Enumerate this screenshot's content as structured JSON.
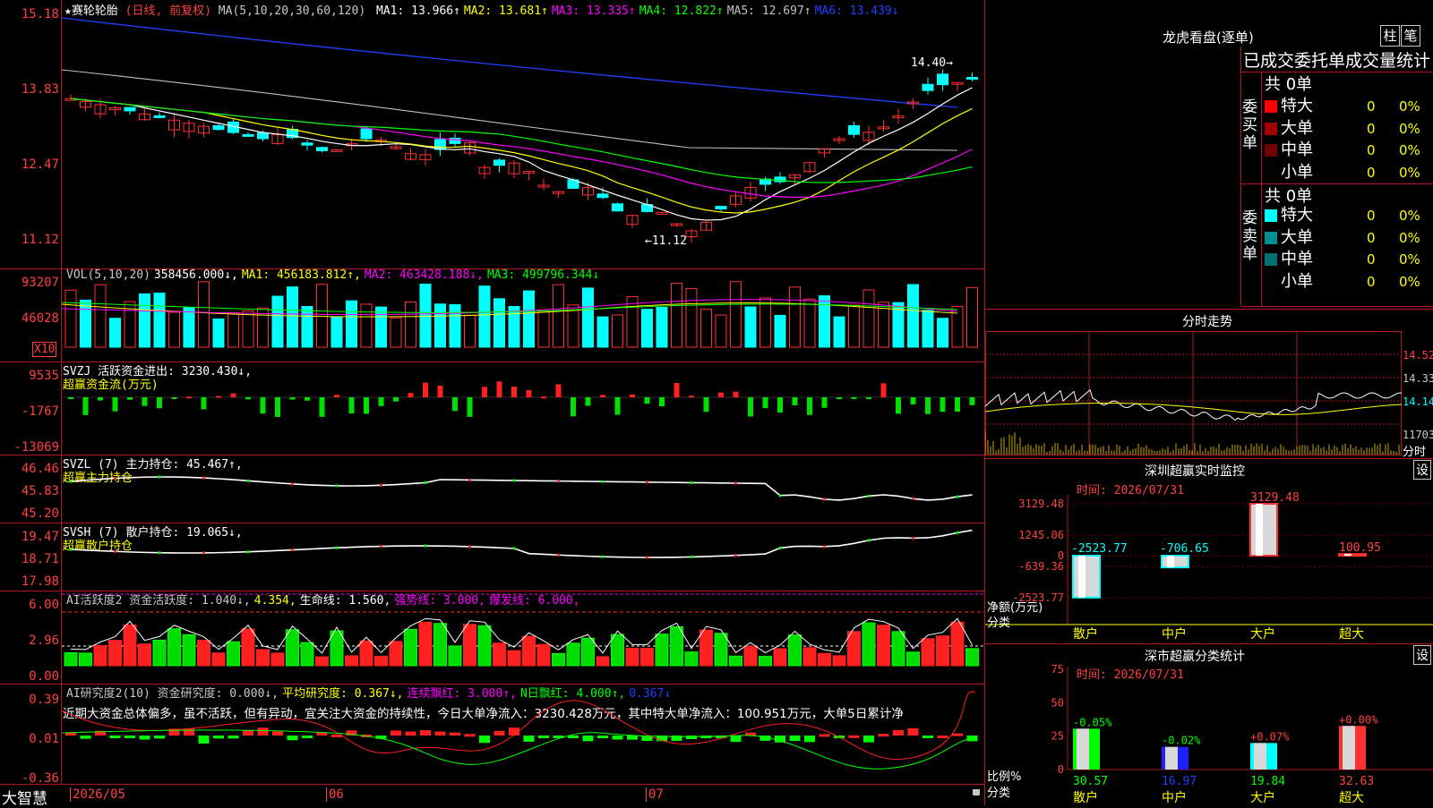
{
  "stock": {
    "name": "★赛轮轮胎",
    "mode": "(日线, 前复权)",
    "ma_label": "MA(5,10,20,30,60,120)",
    "ma": [
      {
        "t": "MA1: 13.966↑",
        "c": "#ffffff"
      },
      {
        "t": "MA2: 13.681↑",
        "c": "#ffff00"
      },
      {
        "t": "MA3: 13.335↑",
        "c": "#ff00ff"
      },
      {
        "t": "MA4: 12.822↑",
        "c": "#00ff00"
      },
      {
        "t": "MA5: 12.697↑",
        "c": "#c0c0c0"
      },
      {
        "t": "MA6: 13.439↓",
        "c": "#2040ff"
      }
    ],
    "high_ann": "14.40→",
    "low_ann": "←11.12"
  },
  "axes": {
    "price": [
      "15.18",
      "13.83",
      "12.47",
      "11.12"
    ],
    "vol": [
      "93207",
      "46028"
    ],
    "vol_unit": "X10",
    "svzj": [
      "9535",
      "-1767",
      "-13069"
    ],
    "svzl": [
      "46.46",
      "45.83",
      "45.20"
    ],
    "svsh": [
      "19.47",
      "18.71",
      "17.98"
    ],
    "ai1": [
      "6.00",
      "2.96",
      "0.00"
    ],
    "ai2": [
      "0.39",
      "0.01",
      "-0.36"
    ]
  },
  "vol_header": [
    {
      "t": "VOL(5,10,20)",
      "c": "#c8c8c8"
    },
    {
      "t": "358456.000↓,",
      "c": "#ffffff"
    },
    {
      "t": "MA1: 456183.812↑,",
      "c": "#ffff00"
    },
    {
      "t": "MA2: 463428.188↓,",
      "c": "#ff00ff"
    },
    {
      "t": "MA3: 499796.344↓",
      "c": "#00ff00"
    }
  ],
  "svzj_header": {
    "line1": "SVZJ  活跃资金进出: 3230.430↓,",
    "line2": "超赢资金流(万元)"
  },
  "svzl_header": {
    "line1": "SVZL (7) 主力持仓: 45.467↑,",
    "line2": "超赢主力持仓"
  },
  "svsh_header": {
    "line1": "SVSH (7) 散户持仓: 19.065↓,",
    "line2": "超赢散户持仓"
  },
  "ai1_header": [
    {
      "t": "AI活跃度2 资金活跃度: 1.040↓,",
      "c": "#c8c8c8"
    },
    {
      "t": "4.354,",
      "c": "#ffff00"
    },
    {
      "t": "生命线: 1.560,",
      "c": "#ffffff"
    },
    {
      "t": "强势线: 3.000,",
      "c": "#ff00ff"
    },
    {
      "t": "爆发线: 6.000,",
      "c": "#ff00ff"
    }
  ],
  "ai2_header": [
    {
      "t": "AI研究度2(10) 资金研究度: 0.000↓,",
      "c": "#c8c8c8"
    },
    {
      "t": "平均研究度: 0.367↓,",
      "c": "#ffff00"
    },
    {
      "t": "连续飘红: 3.000↑,",
      "c": "#ff00ff"
    },
    {
      "t": "N日飘红: 4.000↑,",
      "c": "#00ff00"
    },
    {
      "t": "0.367↓",
      "c": "#2040ff"
    }
  ],
  "ai2_text": "近期大资金总体偏多，虽不活跃，但有异动，宜关注大资金的持续性，今日大单净流入：3230.428万元，其中特大单净流入：100.951万元，大单5日累计净",
  "dates": [
    "2026/05",
    "06",
    "07"
  ],
  "brand": "大智慧",
  "lhb": {
    "title": "龙虎看盘(逐单)",
    "btn1": "柱",
    "btn2": "笔",
    "header": "已成交委托单成交量统计",
    "buy": {
      "side": "委买单",
      "count": "共 0单",
      "rows": [
        {
          "n": "特大",
          "v": "0",
          "p": "0%",
          "c": "#ff0000"
        },
        {
          "n": "大单",
          "v": "0",
          "p": "0%",
          "c": "#a00000"
        },
        {
          "n": "中单",
          "v": "0",
          "p": "0%",
          "c": "#700000"
        },
        {
          "n": "小单",
          "v": "0",
          "p": "0%",
          "c": ""
        }
      ]
    },
    "sell": {
      "side": "委卖单",
      "count": "共 0单",
      "rows": [
        {
          "n": "特大",
          "v": "0",
          "p": "0%",
          "c": "#00ffff"
        },
        {
          "n": "大单",
          "v": "0",
          "p": "0%",
          "c": "#009090"
        },
        {
          "n": "中单",
          "v": "0",
          "p": "0%",
          "c": "#007070"
        },
        {
          "n": "小单",
          "v": "0",
          "p": "0%",
          "c": ""
        }
      ]
    }
  },
  "fenshi": {
    "title": "分时走势",
    "prices": [
      "14.52",
      "14.33",
      "14.14",
      "11703",
      "分时"
    ]
  },
  "sz_mon": {
    "title": "深圳超赢实时监控",
    "btn": "设",
    "time": "时间: 2026/07/31",
    "yaxis": [
      "3129.48",
      "1245.06",
      "0",
      "-639.36",
      "-2523.77"
    ],
    "ylab1": "净额(万元)",
    "ylab2": "分类",
    "cats": [
      {
        "n": "散户",
        "v": -2523.77,
        "t": "-2523.77"
      },
      {
        "n": "中户",
        "v": -706.65,
        "t": "-706.65"
      },
      {
        "n": "大户",
        "v": 3129.48,
        "t": "3129.48"
      },
      {
        "n": "超大",
        "v": 100.95,
        "t": "100.95"
      }
    ]
  },
  "sz_cls": {
    "title": "深市超赢分类统计",
    "btn": "设",
    "time": "时间: 2026/07/31",
    "yaxis": [
      "75",
      "50",
      "25",
      "0"
    ],
    "ylab1": "比例%",
    "ylab2": "分类",
    "cats": [
      {
        "n": "散户",
        "v": 30.57,
        "top": "-0.05%",
        "bot": "30.57",
        "c": "#00ff00"
      },
      {
        "n": "中户",
        "v": 16.97,
        "top": "-0.02%",
        "bot": "16.97",
        "c": "#2020ff"
      },
      {
        "n": "大户",
        "v": 19.84,
        "top": "+0.07%",
        "bot": "19.84",
        "c": "#00ffff"
      },
      {
        "n": "超大",
        "v": 32.63,
        "top": "+0.00%",
        "bot": "32.63",
        "c": "#ff3030"
      }
    ]
  }
}
